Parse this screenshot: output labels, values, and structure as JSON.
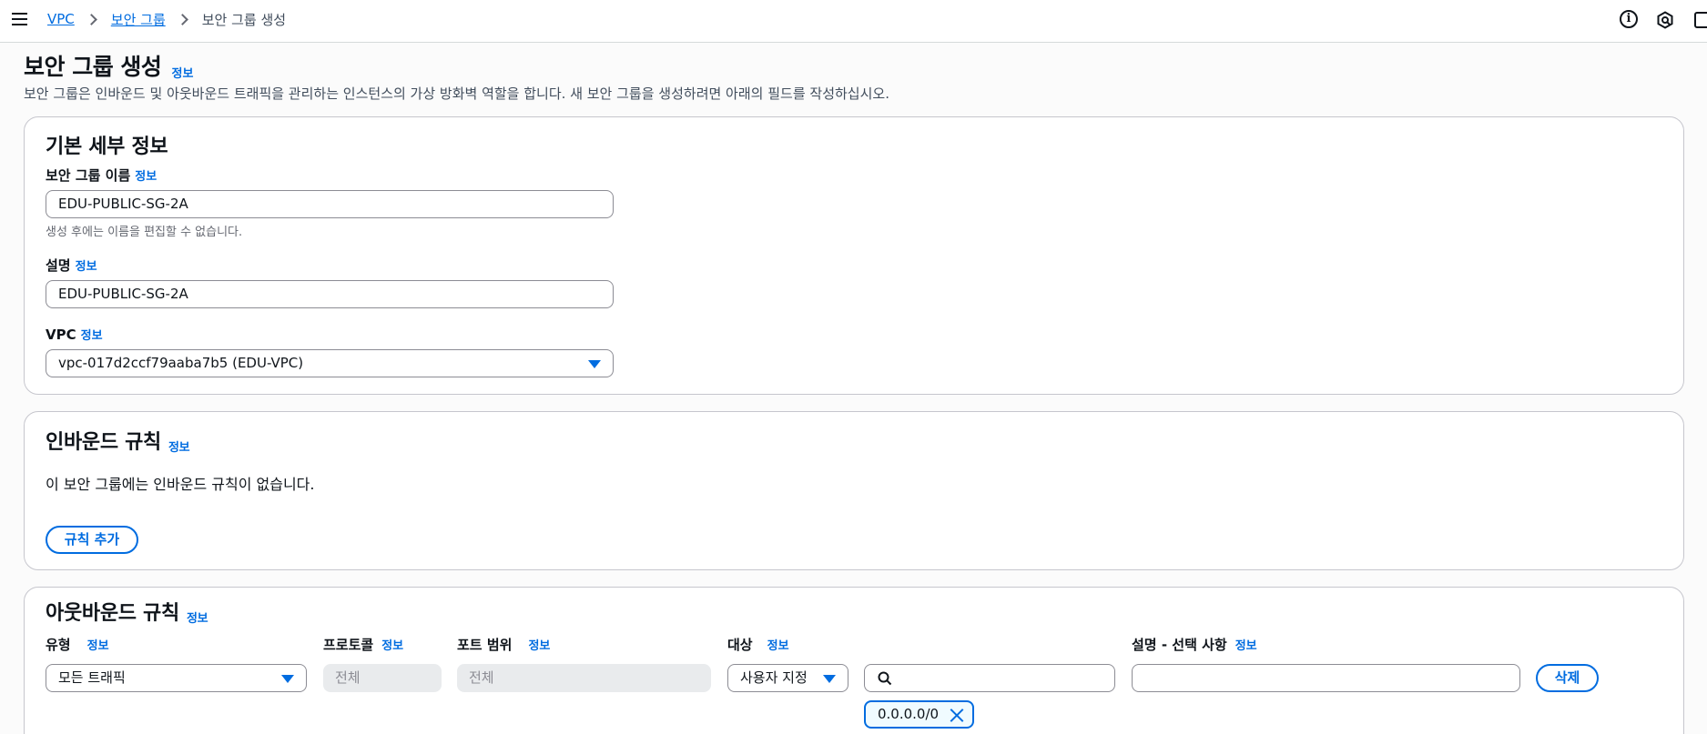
{
  "breadcrumb": {
    "items": [
      "VPC",
      "보안 그룹"
    ],
    "current": "보안 그룹 생성"
  },
  "icons": {
    "menu": "hamburger-menu-icon",
    "info": "info-circle-icon",
    "settings": "hexagon-icon",
    "feedback": "feedback-icon",
    "search": "search-icon",
    "dropdown": "caret-down-icon",
    "remove": "close-icon"
  },
  "header": {
    "title": "보안 그룹 생성",
    "info": "정보",
    "description": "보안 그룹은 인바운드 및 아웃바운드 트래픽을 관리하는 인스턴스의 가상 방화벽 역할을 합니다. 새 보안 그룹을 생성하려면 아래의 필드를 작성하십시오."
  },
  "basic": {
    "title": "기본 세부 정보",
    "name_label": "보안 그룹 이름",
    "name_info": "정보",
    "name_value": "EDU-PUBLIC-SG-2A",
    "name_hint": "생성 후에는 이름을 편집할 수 없습니다.",
    "desc_label": "설명",
    "desc_info": "정보",
    "desc_value": "EDU-PUBLIC-SG-2A",
    "vpc_label": "VPC",
    "vpc_info": "정보",
    "vpc_value": "vpc-017d2ccf79aaba7b5 (EDU-VPC)"
  },
  "inbound": {
    "title": "인바운드 규칙",
    "info": "정보",
    "empty_message": "이 보안 그룹에는 인바운드 규칙이 없습니다.",
    "add_button": "규칙 추가"
  },
  "outbound": {
    "title": "아웃바운드 규칙",
    "info": "정보",
    "columns": {
      "type": "유형",
      "protocol": "프로토콜",
      "port_range": "포트 범위",
      "destination": "대상",
      "description": "설명 - 선택 사항"
    },
    "column_info": "정보",
    "row": {
      "type_value": "모든 트래픽",
      "protocol_value": "전체",
      "port_value": "전체",
      "destination_type": "사용자 지정",
      "search_placeholder": "",
      "token": "0.0.0.0/0",
      "delete_button": "삭제"
    }
  },
  "colors": {
    "link": "#006ce0",
    "border": "#8c8c94",
    "panel_border": "#c6c6cd",
    "disabled_bg": "#e9ebed"
  }
}
